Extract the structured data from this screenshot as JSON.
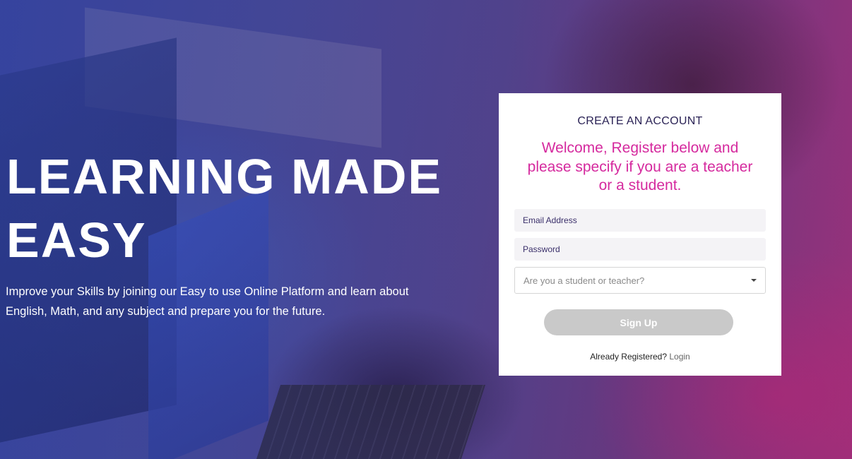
{
  "hero": {
    "title_line1": "LEARNING MADE",
    "title_line2": "EASY",
    "subtitle": "Improve your Skills by joining our Easy to use Online Platform and learn about English, Math, and any subject and prepare you for the future."
  },
  "form": {
    "heading": "CREATE AN ACCOUNT",
    "welcome": "Welcome, Register below and please specify if you are a teacher or a student.",
    "email_placeholder": "Email Address",
    "password_placeholder": "Password",
    "role_select": {
      "selected": "Are you a student or teacher?"
    },
    "signup_label": "Sign Up",
    "already_text": "Already Registered?",
    "login_label": "Login"
  },
  "colors": {
    "accent_pink": "#d52a9e",
    "heading_navy": "#2b2356",
    "button_disabled": "#c9c9c9"
  },
  "icons": {
    "select_caret": "chevron-down-icon"
  }
}
